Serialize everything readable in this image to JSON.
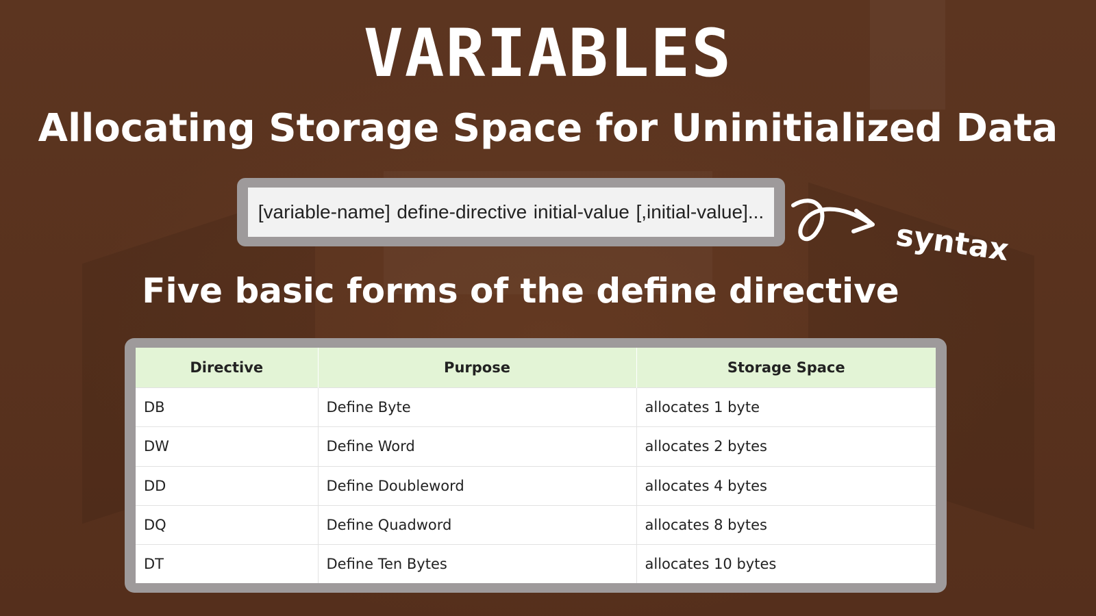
{
  "title": "VARIABLES",
  "subtitle": "Allocating Storage Space for Uninitialized Data",
  "syntax": {
    "parts": [
      "[variable-name]",
      "define-directive",
      "initial-value",
      "[,initial-value]..."
    ],
    "label": "syntax"
  },
  "forms_heading": "Five basic forms of the define directive",
  "table": {
    "headers": [
      "Directive",
      "Purpose",
      "Storage Space"
    ],
    "rows": [
      [
        "DB",
        "Define Byte",
        "allocates 1 byte"
      ],
      [
        "DW",
        "Define Word",
        "allocates 2 bytes"
      ],
      [
        "DD",
        "Define Doubleword",
        "allocates 4 bytes"
      ],
      [
        "DQ",
        "Define Quadword",
        "allocates 8 bytes"
      ],
      [
        "DT",
        "Define Ten Bytes",
        "allocates 10 bytes"
      ]
    ]
  },
  "colors": {
    "background": "#5a331f",
    "header_bg": "#e3f4d6",
    "frame": "#9e9a9b"
  }
}
